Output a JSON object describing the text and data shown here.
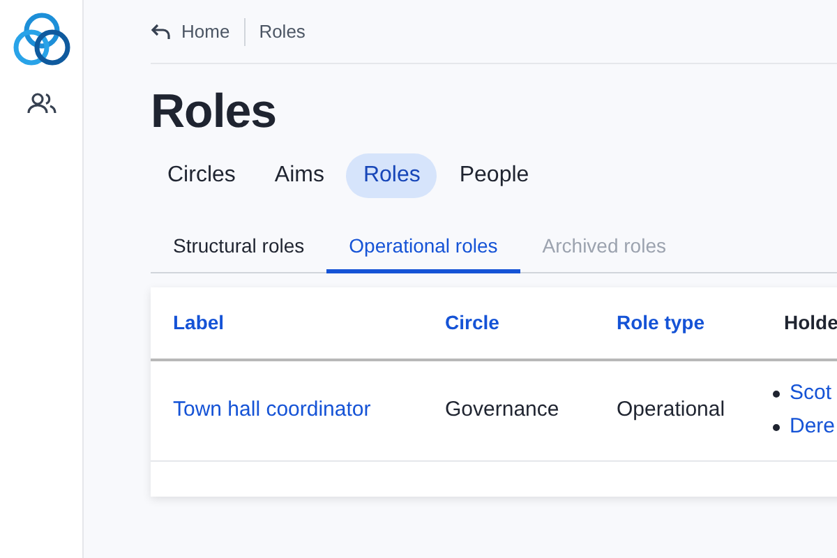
{
  "breadcrumb": [
    {
      "label": "Home"
    },
    {
      "label": "Roles"
    }
  ],
  "page_title": "Roles",
  "tabs": [
    {
      "label": "Circles",
      "selected": false
    },
    {
      "label": "Aims",
      "selected": false
    },
    {
      "label": "Roles",
      "selected": true
    },
    {
      "label": "People",
      "selected": false
    }
  ],
  "subtabs": [
    {
      "label": "Structural roles",
      "selected": false,
      "disabled": false
    },
    {
      "label": "Operational roles",
      "selected": true,
      "disabled": false
    },
    {
      "label": "Archived roles",
      "selected": false,
      "disabled": true
    }
  ],
  "table": {
    "columns": [
      {
        "label": "Label",
        "sortable": true
      },
      {
        "label": "Circle",
        "sortable": true
      },
      {
        "label": "Role type",
        "sortable": true
      },
      {
        "label": "Holde",
        "sortable": false
      }
    ],
    "rows": [
      {
        "label": "Town hall coordinator",
        "circle": "Governance",
        "role_type": "Operational",
        "holders": [
          "Scot",
          "Dere"
        ]
      }
    ]
  }
}
